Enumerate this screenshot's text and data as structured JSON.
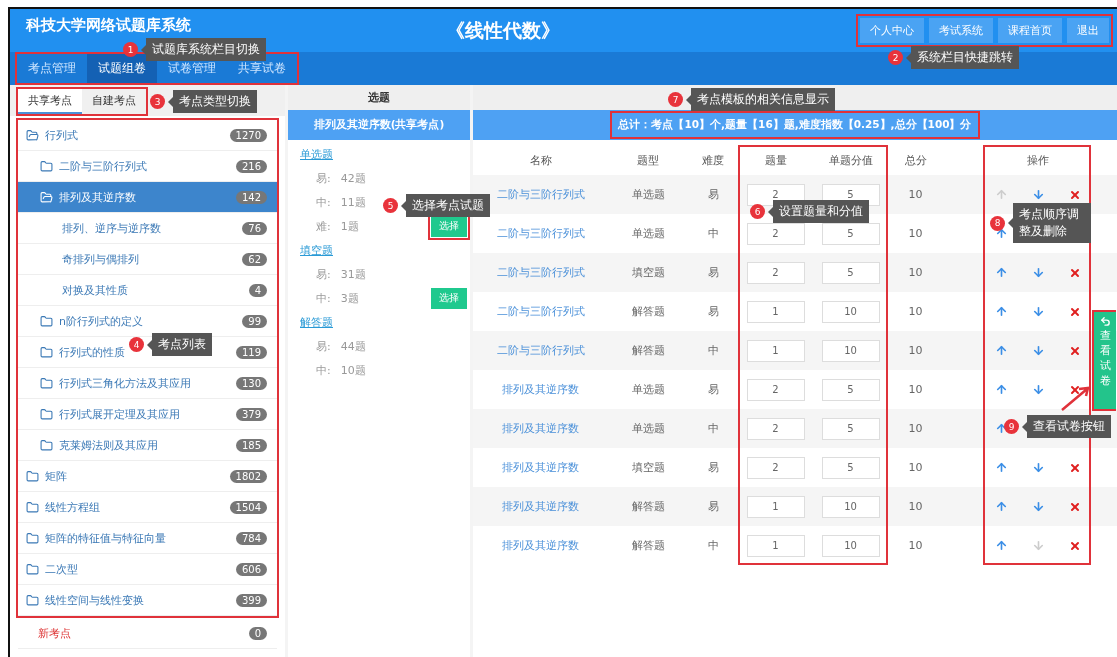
{
  "header": {
    "title": "科技大学网络试题库系统",
    "course": "《线性代数》",
    "links": [
      {
        "label": "个人中心"
      },
      {
        "label": "考试系统"
      },
      {
        "label": "课程首页"
      },
      {
        "label": "退出"
      }
    ]
  },
  "nav": [
    {
      "label": "考点管理",
      "selected": false
    },
    {
      "label": "试题组卷",
      "selected": true
    },
    {
      "label": "试卷管理",
      "selected": false
    },
    {
      "label": "共享试卷",
      "selected": false
    }
  ],
  "left": {
    "tabs": [
      {
        "label": "共享考点",
        "selected": true
      },
      {
        "label": "自建考点",
        "selected": false
      }
    ],
    "tree": [
      {
        "label": "行列式",
        "count": "1270",
        "kind": "folder",
        "expanded": true,
        "selected": false,
        "children": [
          {
            "label": "二阶与三阶行列式",
            "count": "216",
            "kind": "folder",
            "expanded": false,
            "selected": false
          },
          {
            "label": "排列及其逆序数",
            "count": "142",
            "kind": "folder",
            "expanded": true,
            "selected": true,
            "children": [
              {
                "label": "排列、逆序与逆序数",
                "count": "76",
                "kind": "leaf",
                "selected": false
              },
              {
                "label": "奇排列与偶排列",
                "count": "62",
                "kind": "leaf",
                "selected": false
              },
              {
                "label": "对换及其性质",
                "count": "4",
                "kind": "leaf",
                "selected": false
              }
            ]
          },
          {
            "label": "n阶行列式的定义",
            "count": "99",
            "kind": "folder",
            "expanded": false,
            "selected": false
          },
          {
            "label": "行列式的性质",
            "count": "119",
            "kind": "folder",
            "expanded": false,
            "selected": false
          },
          {
            "label": "行列式三角化方法及其应用",
            "count": "130",
            "kind": "folder",
            "expanded": false,
            "selected": false
          },
          {
            "label": "行列式展开定理及其应用",
            "count": "379",
            "kind": "folder",
            "expanded": false,
            "selected": false
          },
          {
            "label": "克莱姆法则及其应用",
            "count": "185",
            "kind": "folder",
            "expanded": false,
            "selected": false
          }
        ]
      },
      {
        "label": "矩阵",
        "count": "1802",
        "kind": "folder",
        "expanded": false,
        "selected": false
      },
      {
        "label": "线性方程组",
        "count": "1504",
        "kind": "folder",
        "expanded": false,
        "selected": false
      },
      {
        "label": "矩阵的特征值与特征向量",
        "count": "784",
        "kind": "folder",
        "expanded": false,
        "selected": false
      },
      {
        "label": "二次型",
        "count": "606",
        "kind": "folder",
        "expanded": false,
        "selected": false
      },
      {
        "label": "线性空间与线性变换",
        "count": "399",
        "kind": "folder",
        "expanded": false,
        "selected": false
      },
      {
        "label": "新考点",
        "count": "0",
        "kind": "new",
        "selected": false
      }
    ]
  },
  "picker": {
    "heading": "选题",
    "topic": "排列及其逆序数(共享考点)",
    "groups": [
      {
        "type": "单选题",
        "levels": [
          {
            "label": "易:",
            "count": "42题"
          },
          {
            "label": "中:",
            "count": "11题"
          },
          {
            "label": "难:",
            "count": "1题",
            "button": "选择"
          }
        ]
      },
      {
        "type": "填空题",
        "levels": [
          {
            "label": "易:",
            "count": "31题"
          },
          {
            "label": "中:",
            "count": "3题",
            "button": "选择"
          }
        ]
      },
      {
        "type": "解答题",
        "levels": [
          {
            "label": "易:",
            "count": "44题"
          },
          {
            "label": "中:",
            "count": "10题"
          }
        ]
      }
    ]
  },
  "table": {
    "summary": "总计：考点【10】个,题量【16】题,难度指数【0.25】,总分【100】分",
    "columns": [
      "名称",
      "题型",
      "难度",
      "题量",
      "单题分值",
      "总分",
      "操作"
    ],
    "rows": [
      {
        "name": "二阶与三阶行列式",
        "type": "单选题",
        "difficulty": "易",
        "quantity": "2",
        "score": "5",
        "total": "10",
        "up_disabled": true,
        "down_disabled": false
      },
      {
        "name": "二阶与三阶行列式",
        "type": "单选题",
        "difficulty": "中",
        "quantity": "2",
        "score": "5",
        "total": "10",
        "up_disabled": false
      },
      {
        "name": "二阶与三阶行列式",
        "type": "填空题",
        "difficulty": "易",
        "quantity": "2",
        "score": "5",
        "total": "10",
        "up_disabled": false,
        "down_disabled": false
      },
      {
        "name": "二阶与三阶行列式",
        "type": "解答题",
        "difficulty": "易",
        "quantity": "1",
        "score": "10",
        "total": "10",
        "up_disabled": false,
        "down_disabled": false
      },
      {
        "name": "二阶与三阶行列式",
        "type": "解答题",
        "difficulty": "中",
        "quantity": "1",
        "score": "10",
        "total": "10",
        "up_disabled": false,
        "down_disabled": false
      },
      {
        "name": "排列及其逆序数",
        "type": "单选题",
        "difficulty": "易",
        "quantity": "2",
        "score": "5",
        "total": "10",
        "up_disabled": false,
        "down_disabled": false
      },
      {
        "name": "排列及其逆序数",
        "type": "单选题",
        "difficulty": "中",
        "quantity": "2",
        "score": "5",
        "total": "10",
        "up_disabled": false
      },
      {
        "name": "排列及其逆序数",
        "type": "填空题",
        "difficulty": "易",
        "quantity": "2",
        "score": "5",
        "total": "10",
        "up_disabled": false,
        "down_disabled": false
      },
      {
        "name": "排列及其逆序数",
        "type": "解答题",
        "difficulty": "易",
        "quantity": "1",
        "score": "10",
        "total": "10",
        "up_disabled": false,
        "down_disabled": false
      },
      {
        "name": "排列及其逆序数",
        "type": "解答题",
        "difficulty": "中",
        "quantity": "1",
        "score": "10",
        "total": "10",
        "up_disabled": false,
        "down_disabled": true
      }
    ]
  },
  "side_button": {
    "label": "查看试卷"
  },
  "annotations": [
    {
      "number": "1",
      "text": "试题库系统栏目切换"
    },
    {
      "number": "2",
      "text": "系统栏目快捷跳转"
    },
    {
      "number": "3",
      "text": "考点类型切换"
    },
    {
      "number": "4",
      "text": "考点列表"
    },
    {
      "number": "5",
      "text": "选择考点试题"
    },
    {
      "number": "6",
      "text": "设置题量和分值"
    },
    {
      "number": "7",
      "text": "考点模板的相关信息显示"
    },
    {
      "number": "8",
      "text": "考点顺序调整及删除"
    },
    {
      "number": "9",
      "text": "查看试卷按钮"
    }
  ]
}
